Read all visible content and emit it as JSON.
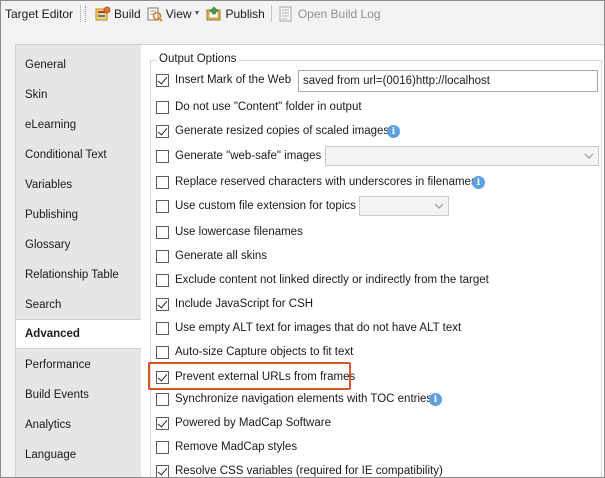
{
  "toolbar": {
    "title": "Target Editor",
    "build_label": "Build",
    "view_label": "View",
    "publish_label": "Publish",
    "open_build_log_label": "Open Build Log"
  },
  "sidebar": {
    "items": [
      {
        "label": "General"
      },
      {
        "label": "Skin"
      },
      {
        "label": "eLearning"
      },
      {
        "label": "Conditional Text"
      },
      {
        "label": "Variables"
      },
      {
        "label": "Publishing"
      },
      {
        "label": "Glossary"
      },
      {
        "label": "Relationship Table"
      },
      {
        "label": "Search"
      },
      {
        "label": "Advanced",
        "active": true
      },
      {
        "label": "Performance"
      },
      {
        "label": "Build Events"
      },
      {
        "label": "Analytics"
      },
      {
        "label": "Language"
      }
    ]
  },
  "output_options": {
    "title": "Output Options",
    "options": [
      {
        "label": "Insert Mark of the Web",
        "checked": true
      },
      {
        "label": "Do not use \"Content\" folder in output",
        "checked": false
      },
      {
        "label": "Generate resized copies of scaled images",
        "checked": true
      },
      {
        "label": "Generate \"web-safe\" images",
        "checked": false
      },
      {
        "label": "Replace reserved characters with underscores in filenames",
        "checked": false
      },
      {
        "label": "Use custom file extension for topics",
        "checked": false
      },
      {
        "label": "Use lowercase filenames",
        "checked": false
      },
      {
        "label": "Generate all skins",
        "checked": false
      },
      {
        "label": "Exclude content not linked directly or indirectly from the target",
        "checked": false
      },
      {
        "label": "Include JavaScript for CSH",
        "checked": true
      },
      {
        "label": "Use empty ALT text for images that do not have ALT text",
        "checked": false
      },
      {
        "label": "Auto-size Capture objects to fit text",
        "checked": false
      },
      {
        "label": "Prevent external URLs from frames",
        "checked": true
      },
      {
        "label": "Synchronize navigation elements with TOC entries",
        "checked": false
      },
      {
        "label": "Powered by MadCap Software",
        "checked": true
      },
      {
        "label": "Remove MadCap styles",
        "checked": false
      },
      {
        "label": "Resolve CSS variables (required for IE compatibility)",
        "checked": true
      }
    ],
    "mark_of_web_value": "saved from url=(0016)http://localhost"
  },
  "colors": {
    "highlight": "#d6562b",
    "info": "#5ea0e0"
  }
}
